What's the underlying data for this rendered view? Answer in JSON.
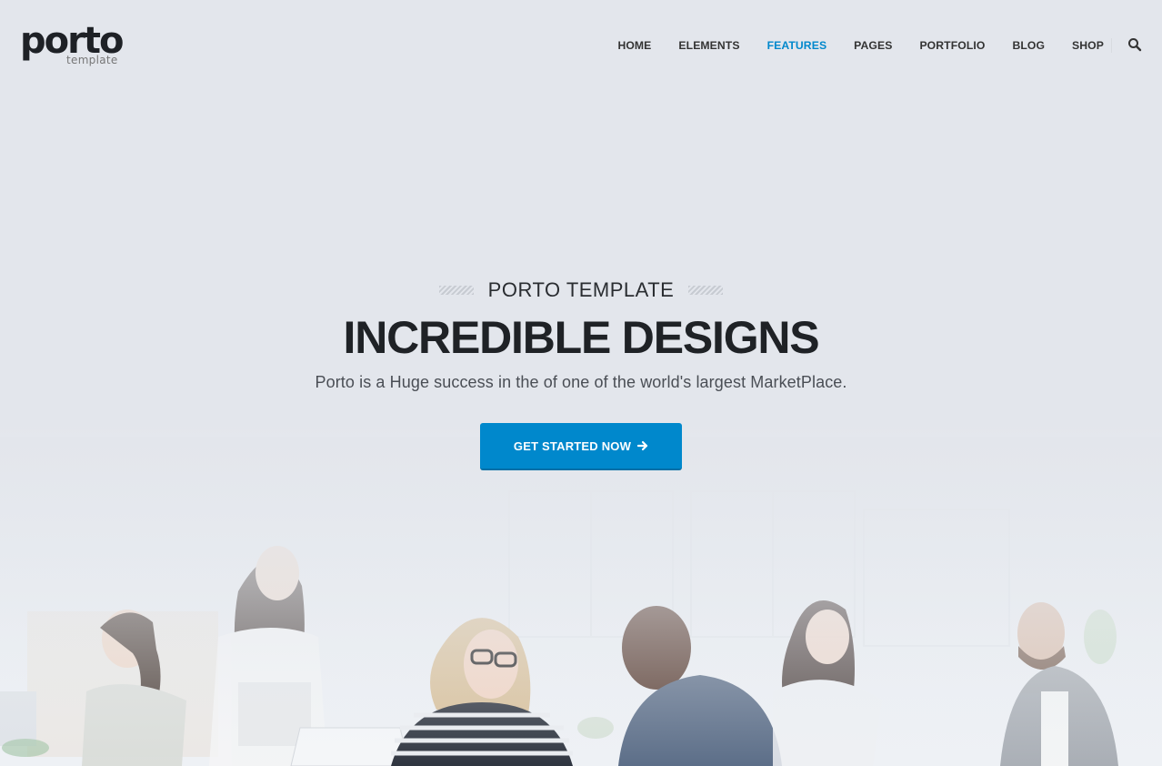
{
  "brand": {
    "logo_main": "porto",
    "logo_sub": "template"
  },
  "nav": {
    "items": [
      {
        "label": "HOME"
      },
      {
        "label": "ELEMENTS"
      },
      {
        "label": "FEATURES",
        "active": true
      },
      {
        "label": "PAGES"
      },
      {
        "label": "PORTFOLIO"
      },
      {
        "label": "BLOG"
      },
      {
        "label": "SHOP"
      }
    ],
    "search_icon": "search-icon"
  },
  "hero": {
    "kicker": "PORTO TEMPLATE",
    "headline": "INCREDIBLE DESIGNS",
    "subline": "Porto is a Huge success in the of one of the world's largest MarketPlace.",
    "cta_label": "GET STARTED NOW",
    "cta_icon": "arrow-right-icon",
    "background_image": "office-team-photo"
  },
  "colors": {
    "accent": "#0088cc",
    "background": "#e3e6ec",
    "text_dark": "#222529"
  }
}
